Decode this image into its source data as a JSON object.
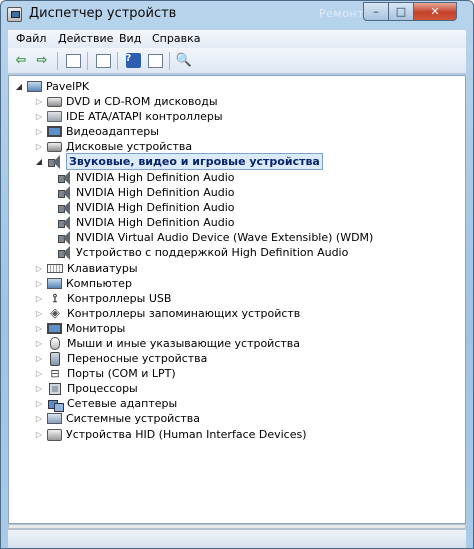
{
  "window": {
    "title": "Диспетчер устройств",
    "watermark": "Ремонт ПК",
    "controls": {
      "minimize": "–",
      "maximize": "□",
      "close": "✕"
    }
  },
  "menu": [
    {
      "label": "Файл"
    },
    {
      "label": "Действие"
    },
    {
      "label": "Вид"
    },
    {
      "label": "Справка"
    }
  ],
  "toolbar": {
    "buttons": [
      {
        "icon": "back-arrow-icon"
      },
      {
        "icon": "forward-arrow-icon"
      },
      {
        "icon": "show-hide-tree-icon"
      },
      {
        "icon": "properties-icon"
      },
      {
        "icon": "help-icon"
      },
      {
        "icon": "view-icon"
      },
      {
        "icon": "scan-hardware-icon"
      }
    ]
  },
  "tree": {
    "root": "PavelPK",
    "categories": [
      {
        "label": "DVD и CD-ROM дисководы",
        "icon": "dvd-drive-icon"
      },
      {
        "label": "IDE ATA/ATAPI контроллеры",
        "icon": "ide-controller-icon"
      },
      {
        "label": "Видеоадаптеры",
        "icon": "display-adapter-icon"
      },
      {
        "label": "Дисковые устройства",
        "icon": "disk-drive-icon"
      },
      {
        "label": "Звуковые, видео и игровые устройства",
        "icon": "sound-device-icon",
        "expanded": true,
        "selected": true,
        "children": [
          "NVIDIA High Definition Audio",
          "NVIDIA High Definition Audio",
          "NVIDIA High Definition Audio",
          "NVIDIA High Definition Audio",
          "NVIDIA Virtual Audio Device (Wave Extensible) (WDM)",
          "Устройство с поддержкой High Definition Audio"
        ]
      },
      {
        "label": "Клавиатуры",
        "icon": "keyboard-icon"
      },
      {
        "label": "Компьютер",
        "icon": "computer-icon"
      },
      {
        "label": "Контроллеры USB",
        "icon": "usb-icon"
      },
      {
        "label": "Контроллеры запоминающих устройств",
        "icon": "storage-controller-icon"
      },
      {
        "label": "Мониторы",
        "icon": "monitor-icon"
      },
      {
        "label": "Мыши и иные указывающие устройства",
        "icon": "mouse-icon"
      },
      {
        "label": "Переносные устройства",
        "icon": "portable-device-icon"
      },
      {
        "label": "Порты (COM и LPT)",
        "icon": "port-icon"
      },
      {
        "label": "Процессоры",
        "icon": "processor-icon"
      },
      {
        "label": "Сетевые адаптеры",
        "icon": "network-adapter-icon"
      },
      {
        "label": "Системные устройства",
        "icon": "system-device-icon"
      },
      {
        "label": "Устройства HID (Human Interface Devices)",
        "icon": "hid-icon"
      }
    ]
  }
}
